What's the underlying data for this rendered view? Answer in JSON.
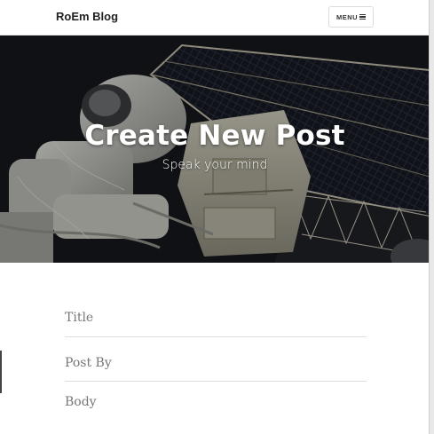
{
  "navbar": {
    "brand": "RoEm Blog",
    "menu_label": "MENU",
    "menu_icon": "hamburger-icon"
  },
  "header": {
    "title": "Create New Post",
    "subtitle": "Speak your mind",
    "background": "astronaut-space-station-image"
  },
  "form": {
    "title_placeholder": "Title",
    "post_by_placeholder": "Post By",
    "body_placeholder": "Body",
    "title_value": "",
    "post_by_value": "",
    "body_value": ""
  }
}
